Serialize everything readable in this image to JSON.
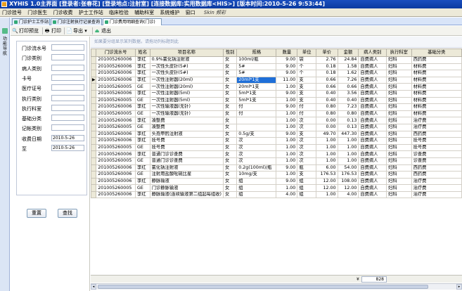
{
  "window": {
    "title": "XYHIS 1.0主界面  [登录者:张春花] [登录地点:注射室] [连接数据库:实用数据库<HIS>] [版本时间:2010-5-26 9:53:44]"
  },
  "menu": [
    "门诊挂号",
    "门诊医生",
    "门诊收费",
    "护士工作站",
    "临床检验",
    "辅助科室",
    "系统维护",
    "窗口"
  ],
  "skin_label": "Skin 频彩",
  "tabs": [
    "门诊护士工作站",
    "门诊注射执行记录查询",
    "门诊费用明细查询(门诊)"
  ],
  "left_strip_label": "功能导航",
  "toolbar": {
    "preview": "打印预览",
    "print": "打印",
    "export": "导出",
    "exit": "退出"
  },
  "form": {
    "fields": [
      {
        "label": "门诊流水号",
        "value": ""
      },
      {
        "label": "门诊类别",
        "value": ""
      },
      {
        "label": "病人类别",
        "value": ""
      },
      {
        "label": "卡号",
        "value": ""
      },
      {
        "label": "医疗证号",
        "value": ""
      },
      {
        "label": "执行类别",
        "value": ""
      },
      {
        "label": "执行科室",
        "value": ""
      },
      {
        "label": "基础分类",
        "value": ""
      },
      {
        "label": "记帐类别",
        "value": ""
      },
      {
        "label": "收费日期",
        "value": "2010-5-26"
      },
      {
        "label": "至",
        "value": "2010-5-26"
      }
    ],
    "reset_label": "重置",
    "search_label": "查找"
  },
  "group_hint": "如果要分组显示某列数据，请拖动列标题到此",
  "table": {
    "columns": [
      "门诊流水号",
      "姓名",
      "项目名称",
      "性别",
      "规格",
      "数量",
      "单位",
      "单价",
      "金额",
      "病人类别",
      "执行科室",
      "基础分类"
    ],
    "rows": [
      [
        "201005260006",
        "李红",
        "0.9%氯化钠注射液",
        "女",
        "100ml/瓶",
        "9.00",
        "袋",
        "2.76",
        "24.84",
        "自费病人",
        "妇科",
        "西药费"
      ],
      [
        "201005260006",
        "李红",
        "一次性头皮针(5#)",
        "女",
        "5#",
        "9.00",
        "个",
        "0.18",
        "1.58",
        "自费病人",
        "妇科",
        "材料费"
      ],
      [
        "201005260006",
        "李红",
        "一次性头皮针(5#)",
        "女",
        "5#",
        "9.00",
        "个",
        "0.18",
        "1.62",
        "自费病人",
        "妇科",
        "材料费"
      ],
      [
        "201005260006",
        "李红",
        "一次性注射器(20ml)",
        "女",
        "20ml*1支",
        "11.00",
        "支",
        "0.66",
        "7.26",
        "自费病人",
        "妇科",
        "材料费"
      ],
      [
        "201005260005",
        "GE",
        "一次性注射器(20ml)",
        "女",
        "20ml*1支",
        "1.00",
        "支",
        "0.66",
        "0.66",
        "自费病人",
        "妇科",
        "材料费"
      ],
      [
        "201005260006",
        "李红",
        "一次性注射器(5ml)",
        "女",
        "5ml*1支",
        "9.00",
        "支",
        "0.40",
        "3.56",
        "自费病人",
        "妇科",
        "材料费"
      ],
      [
        "201005260005",
        "GE",
        "一次性注射器(5ml)",
        "女",
        "5ml*1支",
        "1.00",
        "支",
        "0.40",
        "0.40",
        "自费病人",
        "妇科",
        "材料费"
      ],
      [
        "201005260006",
        "李红",
        "一次性输液器(无针)",
        "女",
        "付",
        "9.00",
        "付",
        "0.80",
        "7.23",
        "自费病人",
        "妇科",
        "材料费"
      ],
      [
        "201005260005",
        "GE",
        "一次性输液器(无针)",
        "女",
        "付",
        "1.00",
        "付",
        "0.80",
        "0.80",
        "自费病人",
        "妇科",
        "材料费"
      ],
      [
        "201005260006",
        "李红",
        "凑整费",
        "女",
        "",
        "1.00",
        "次",
        "0.00",
        "0.13",
        "自费病人",
        "妇科",
        "治疗费"
      ],
      [
        "201005260005",
        "GE",
        "凑整费",
        "女",
        "",
        "1.00",
        "次",
        "0.00",
        "0.13",
        "自费病人",
        "妇科",
        "治疗费"
      ],
      [
        "201005260006",
        "李红",
        "头孢甲肟注射液",
        "女",
        "0.5g/支",
        "9.00",
        "支",
        "49.70",
        "447.30",
        "自费病人",
        "妇科",
        "西药费"
      ],
      [
        "201005260006",
        "李红",
        "挂号费",
        "女",
        "次",
        "1.00",
        "次",
        "1.00",
        "1.00",
        "自费病人",
        "妇科",
        "挂号费"
      ],
      [
        "201005260005",
        "GE",
        "挂号费",
        "女",
        "次",
        "1.00",
        "次",
        "1.00",
        "1.00",
        "自费病人",
        "妇科",
        "挂号费"
      ],
      [
        "201005260006",
        "李红",
        "普通门诊诊查费",
        "女",
        "次",
        "1.00",
        "次",
        "1.00",
        "1.00",
        "自费病人",
        "妇科",
        "诊查费"
      ],
      [
        "201005260005",
        "GE",
        "普通门诊诊查费",
        "女",
        "次",
        "1.00",
        "次",
        "1.00",
        "1.00",
        "自费病人",
        "妇科",
        "诊查费"
      ],
      [
        "201005260006",
        "李红",
        "氯化钠注射液",
        "女",
        "0.2g(100ml)/瓶",
        "9.00",
        "瓶",
        "6.00",
        "54.00",
        "自费病人",
        "妇科",
        "西药费"
      ],
      [
        "201005260006",
        "GE",
        "注射用盐酸吡硫比星",
        "女",
        "10mg/支",
        "1.00",
        "支",
        "176.53",
        "176.53",
        "自费病人",
        "妇科",
        "西药费"
      ],
      [
        "201005260006",
        "李红",
        "静脉输液",
        "女",
        "组",
        "9.00",
        "组",
        "12.00",
        "108.00",
        "自费病人",
        "妇科",
        "治疗费"
      ],
      [
        "201005260005",
        "GE",
        "门诊静脉输液",
        "女",
        "组",
        "1.00",
        "组",
        "12.00",
        "12.00",
        "自费病人",
        "妇科",
        "治疗费"
      ],
      [
        "201005260006",
        "李红",
        "静脉输液(连续输液第二组起每组收)",
        "女",
        "组",
        "4.00",
        "组",
        "1.00",
        "4.00",
        "自费病人",
        "妇科",
        "治疗费"
      ]
    ]
  },
  "footer": {
    "sum_symbol": "¥",
    "total": "828"
  }
}
